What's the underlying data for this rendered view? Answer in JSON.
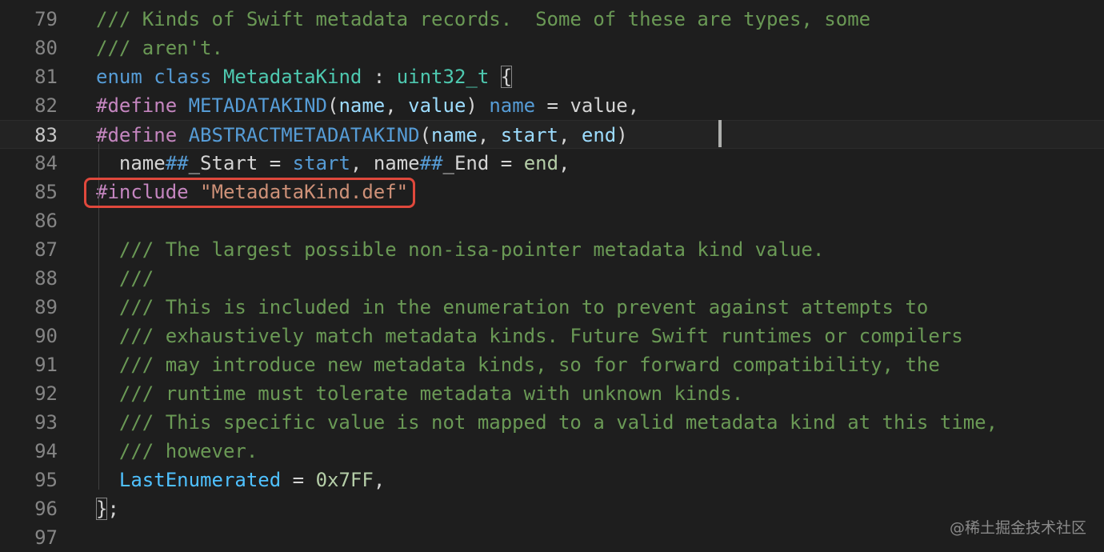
{
  "editor": {
    "lines": [
      {
        "number": "79",
        "tokens": [
          {
            "t": "/// Kinds of Swift metadata records.  Some of these are types, some",
            "c": "c"
          }
        ]
      },
      {
        "number": "80",
        "tokens": [
          {
            "t": "/// aren't.",
            "c": "c"
          }
        ]
      },
      {
        "number": "81",
        "tokens": [
          {
            "t": "enum",
            "c": "kw"
          },
          {
            "t": " ",
            "c": "pl"
          },
          {
            "t": "class",
            "c": "kw"
          },
          {
            "t": " ",
            "c": "pl"
          },
          {
            "t": "MetadataKind",
            "c": "ty"
          },
          {
            "t": " : ",
            "c": "pl"
          },
          {
            "t": "uint32_t",
            "c": "ty"
          },
          {
            "t": " ",
            "c": "pl"
          },
          {
            "t": "{",
            "c": "br"
          }
        ]
      },
      {
        "number": "82",
        "tokens": [
          {
            "t": "#define",
            "c": "pp"
          },
          {
            "t": " ",
            "c": "pl"
          },
          {
            "t": "METADATAKIND",
            "c": "kw"
          },
          {
            "t": "(",
            "c": "pl"
          },
          {
            "t": "name",
            "c": "id"
          },
          {
            "t": ", ",
            "c": "pl"
          },
          {
            "t": "value",
            "c": "id"
          },
          {
            "t": ") ",
            "c": "pl"
          },
          {
            "t": "name",
            "c": "kw"
          },
          {
            "t": " = ",
            "c": "pl"
          },
          {
            "t": "value",
            "c": "pl"
          },
          {
            "t": ",",
            "c": "pl"
          }
        ]
      },
      {
        "number": "83",
        "current": true,
        "tokens": [
          {
            "t": "#define",
            "c": "pp"
          },
          {
            "t": " ",
            "c": "pl"
          },
          {
            "t": "ABSTRACTMETADATAKIND",
            "c": "kw"
          },
          {
            "t": "(",
            "c": "pl"
          },
          {
            "t": "name",
            "c": "id"
          },
          {
            "t": ", ",
            "c": "pl"
          },
          {
            "t": "start",
            "c": "id"
          },
          {
            "t": ", ",
            "c": "pl"
          },
          {
            "t": "end",
            "c": "id"
          },
          {
            "t": ")",
            "c": "pl"
          },
          {
            "t": "                          ",
            "c": "pl"
          },
          {
            "t": "                       ",
            "c": "pl"
          },
          {
            "t": "\\",
            "c": "nm"
          }
        ]
      },
      {
        "number": "84",
        "tokens": [
          {
            "t": "  name",
            "c": "pl"
          },
          {
            "t": "##",
            "c": "kw"
          },
          {
            "t": "_Start",
            "c": "pl"
          },
          {
            "t": " = ",
            "c": "pl"
          },
          {
            "t": "start",
            "c": "kw"
          },
          {
            "t": ", ",
            "c": "pl"
          },
          {
            "t": "name",
            "c": "pl"
          },
          {
            "t": "##",
            "c": "kw"
          },
          {
            "t": "_End",
            "c": "pl"
          },
          {
            "t": " = ",
            "c": "pl"
          },
          {
            "t": "end",
            "c": "nm"
          },
          {
            "t": ",",
            "c": "pl"
          }
        ]
      },
      {
        "number": "85",
        "tokens": [
          {
            "t": "#include",
            "c": "pp"
          },
          {
            "t": " ",
            "c": "pl"
          },
          {
            "t": "\"MetadataKind.def\"",
            "c": "st"
          }
        ]
      },
      {
        "number": "86",
        "tokens": []
      },
      {
        "number": "87",
        "tokens": [
          {
            "t": "  /// The largest possible non-isa-pointer metadata kind value.",
            "c": "c"
          }
        ]
      },
      {
        "number": "88",
        "tokens": [
          {
            "t": "  ///",
            "c": "c"
          }
        ]
      },
      {
        "number": "89",
        "tokens": [
          {
            "t": "  /// This is included in the enumeration to prevent against attempts to",
            "c": "c"
          }
        ]
      },
      {
        "number": "90",
        "tokens": [
          {
            "t": "  /// exhaustively match metadata kinds. Future Swift runtimes or compilers",
            "c": "c"
          }
        ]
      },
      {
        "number": "91",
        "tokens": [
          {
            "t": "  /// may introduce new metadata kinds, so for forward compatibility, the",
            "c": "c"
          }
        ]
      },
      {
        "number": "92",
        "tokens": [
          {
            "t": "  /// runtime must tolerate metadata with unknown kinds.",
            "c": "c"
          }
        ]
      },
      {
        "number": "93",
        "tokens": [
          {
            "t": "  /// This specific value is not mapped to a valid metadata kind at this time,",
            "c": "c"
          }
        ]
      },
      {
        "number": "94",
        "tokens": [
          {
            "t": "  /// however.",
            "c": "c"
          }
        ]
      },
      {
        "number": "95",
        "tokens": [
          {
            "t": "  ",
            "c": "pl"
          },
          {
            "t": "LastEnumerated",
            "c": "fn"
          },
          {
            "t": " = ",
            "c": "pl"
          },
          {
            "t": "0x7FF",
            "c": "nm"
          },
          {
            "t": ",",
            "c": "pl"
          }
        ]
      },
      {
        "number": "96",
        "tokens": [
          {
            "t": "}",
            "c": "br"
          },
          {
            "t": ";",
            "c": "pl"
          }
        ]
      },
      {
        "number": "97",
        "tokens": []
      }
    ]
  },
  "watermark": "@稀土掘金技术社区",
  "colors": {
    "background": "#1e1e1e",
    "comment": "#6a9955",
    "keyword": "#569cd6",
    "preprocessor": "#c586c0",
    "string": "#ce9178",
    "highlight_box": "#e0483c"
  }
}
